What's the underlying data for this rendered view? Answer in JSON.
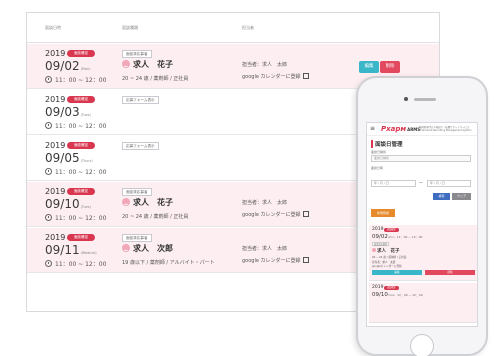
{
  "table": {
    "headers": [
      "面談日時",
      "面談種類",
      "担当者"
    ],
    "badge_label": "面談確定",
    "edit_label": "編集",
    "delete_label": "削除",
    "rows": [
      {
        "year": "2019",
        "date": "09/02",
        "dow": "(Mon)",
        "time": "11：00 ~ 12：00",
        "tag": "面談済応募者",
        "name": "求人　花子",
        "meta": "20 ~ 24 歳 / 薬剤師 / 正社員",
        "person": "担当者：求人　太郎",
        "gcal": "google カレンダーに登録"
      },
      {
        "year": "2019",
        "date": "09/03",
        "dow": "(Tues)",
        "time": "11：00 ~ 12：00",
        "tag": "応募フォーム表示"
      },
      {
        "year": "2019",
        "date": "09/05",
        "dow": "(Thurs)",
        "time": "11：00 ~ 12：00",
        "tag": "応募フォーム表示"
      },
      {
        "year": "2019",
        "date": "09/10",
        "dow": "(Tues)",
        "time": "11：00 ~ 12：00",
        "tag": "面談済応募者",
        "name": "求人　花子",
        "meta": "20 ~ 24 歳 / 薬剤師 / 正社員",
        "person": "担当者：求人　太郎",
        "gcal": "google カレンダーに登録"
      },
      {
        "year": "2019",
        "date": "09/11",
        "dow": "(Wednes)",
        "time": "11：00 ~ 12：00",
        "tag": "面談済応募者",
        "name": "求人　次郎",
        "meta": "19 歳以下 / 薬剤師 / アルバイト・パート",
        "person": "担当者：求人　太郎",
        "gcal": "google カレンダーに登録"
      }
    ]
  },
  "phone": {
    "menu_icon": "≡",
    "logo_main": "Pхарм",
    "logo_sub": "ARMS",
    "logo_tag": "薬剤師専門の人材紹介・転職サポートサービス Pharmacist Recruiting Management System",
    "page_title": "面談日管理",
    "field1_label": "面談日種別",
    "field1_placeholder": "面談日種別",
    "field2_label": "面談日時",
    "date_from": "年 / 月 / 日",
    "date_to": "年 / 月 / 日",
    "tilde": "～",
    "search_label": "検索",
    "clear_label": "クリア",
    "add_label": "新規登録",
    "cards": [
      {
        "year": "2019",
        "badge": "面談確定",
        "date": "09/02",
        "dow": "(Mon)",
        "time": "11：00 ~ 12：00",
        "tag": "面談済応募者",
        "name": "求人　花子",
        "meta": "20 ~ 24 歳 / 薬剤師 / 正社員",
        "person": "担当者：求人　太郎",
        "gcal": "googleカレンダーに登録",
        "edit": "編集",
        "del": "削除"
      },
      {
        "year": "2019",
        "badge": "面談確定",
        "date": "09/10",
        "dow": "(Tues)",
        "time": "11：00 ~ 12：00"
      }
    ]
  },
  "colors": {
    "accent_red": "#d8374f",
    "edit_teal": "#3ab6c9",
    "delete_red": "#e2485e",
    "row_pink": "#fdeef1",
    "search_blue": "#3d6cc0",
    "add_orange": "#e68a2c"
  }
}
